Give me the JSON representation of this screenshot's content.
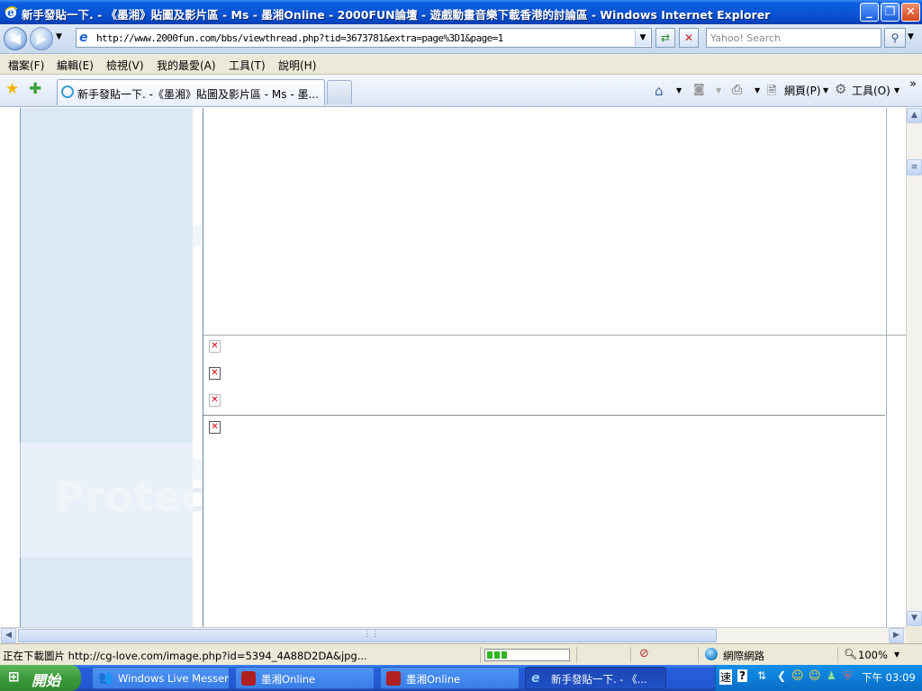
{
  "window": {
    "title": "新手發貼一下. - 《墨湘》貼圖及影片區 - Ms - 墨湘Online - 2000FUN論壇 - 遊戲動畫音樂下載香港的討論區 - Windows Internet Explorer"
  },
  "address": {
    "url": "http://www.2000fun.com/bbs/viewthread.php?tid=3673781&extra=page%3D1&page=1"
  },
  "search": {
    "placeholder": "Yahoo! Search"
  },
  "menu": {
    "items": [
      "檔案(F)",
      "編輯(E)",
      "檢視(V)",
      "我的最愛(A)",
      "工具(T)",
      "說明(H)"
    ]
  },
  "tabs": {
    "active_label": "新手發貼一下. -《墨湘》貼圖及影片區 - Ms - 墨..."
  },
  "toolbar": {
    "page_label": "網頁(P)",
    "tools_label": "工具(O)",
    "more": "»"
  },
  "content": {
    "watermark": "Protec"
  },
  "status": {
    "text": "正在下載圖片 http://cg-love.com/image.php?id=5394_4A88D2DA&jpg...",
    "zone": "網際網路",
    "zoom": "100%",
    "progress": 0.25
  },
  "taskbar": {
    "start_label": "開始",
    "tasks": [
      "Windows Live Messen...",
      "墨湘Online",
      "墨湘Online",
      "新手發貼一下. - 《..."
    ],
    "clock": "下午 03:09"
  },
  "colors": {
    "titlebar": "#0a55d8",
    "taskbar": "#245edc",
    "start": "#3c9a3c",
    "content_band": "#dde8f6"
  }
}
